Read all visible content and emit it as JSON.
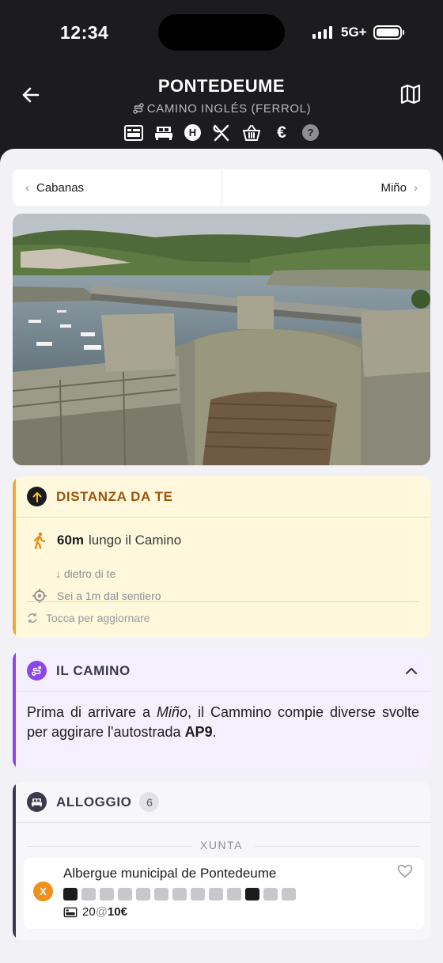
{
  "status": {
    "time": "12:34",
    "network": "5G+"
  },
  "header": {
    "title": "PONTEDEUME",
    "route": "CAMINO INGLÉS (FERROL)",
    "facility_icons": [
      "hostel-icon",
      "bed-icon",
      "hotel-icon",
      "restaurant-icon",
      "shop-icon",
      "cash-icon",
      "info-icon"
    ]
  },
  "stage_nav": {
    "prev": "Cabanas",
    "next": "Miño"
  },
  "distance": {
    "title": "DISTANZA DA TE",
    "amount": "60m",
    "along": "lungo il Camino",
    "behind": "dietro di te",
    "offpath": "Sei a 1m dal sentiero",
    "refresh": "Tocca per aggiornare"
  },
  "camino": {
    "title": "IL CAMINO",
    "text_before": "Prima di arrivare a ",
    "place": "Miño",
    "text_middle": ", il Cammino compie diverse svolte per aggirare l'autostrada ",
    "road": "AP9",
    "text_end": "."
  },
  "alloggio": {
    "title": "ALLOGGIO",
    "count": "6",
    "group": "XUNTA",
    "entry": {
      "badge": "X",
      "name": "Albergue municipal de Pontedeume",
      "beds": "20",
      "at": "@",
      "price": "10€"
    }
  },
  "colors": {
    "distance_accent": "#f0a830",
    "camino_accent": "#8e44ec",
    "alloggio_accent": "#3a3a4c",
    "badge_orange": "#f0901c"
  }
}
